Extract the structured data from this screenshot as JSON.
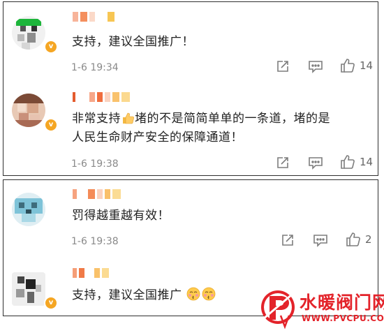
{
  "comments": [
    {
      "text": "支持，建议全国推广！",
      "time": "1-6 19:34",
      "likes": "14"
    },
    {
      "text_a": "非常支持",
      "text_b": "堵的不是简简单单的一条道，堵的是",
      "text_c": "人民生命财产安全的保障通道！",
      "time": "1-6 19:38",
      "likes": "14"
    },
    {
      "text": "罚得越重越有效！",
      "time": "1-6 19:38",
      "likes": "2"
    },
    {
      "text": "支持，建议全国推广"
    }
  ],
  "icons": {
    "verified": "verified-badge-icon",
    "share": "share-icon",
    "comment": "comment-icon",
    "like": "thumbs-up-icon"
  },
  "watermark": {
    "title": "水暖阀门网",
    "url": "WWW.PVCPU.COM",
    "color": "#e3232a"
  },
  "colors": {
    "badge": "#f5a623",
    "time": "#8a8a8a",
    "text": "#222222"
  }
}
